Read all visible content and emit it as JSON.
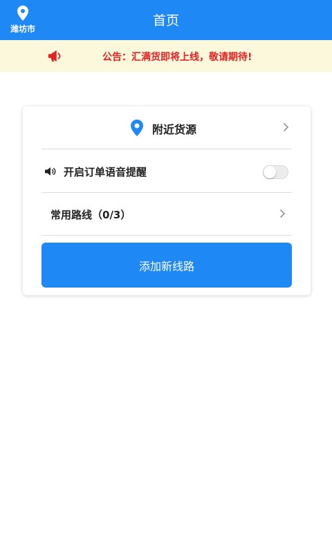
{
  "header": {
    "city": "潍坊市",
    "title": "首页"
  },
  "notice": {
    "text": "公告：汇满货即将上线，敬请期待!"
  },
  "card": {
    "nearby_label": "附近货源",
    "voice_label": "开启订单语音提醒",
    "voice_enabled": false,
    "routes_label": "常用路线（0/3）",
    "add_button": "添加新线路"
  },
  "colors": {
    "primary": "#1e88f5",
    "notice_bg": "#fcf8dc",
    "notice_text": "#e32222"
  }
}
